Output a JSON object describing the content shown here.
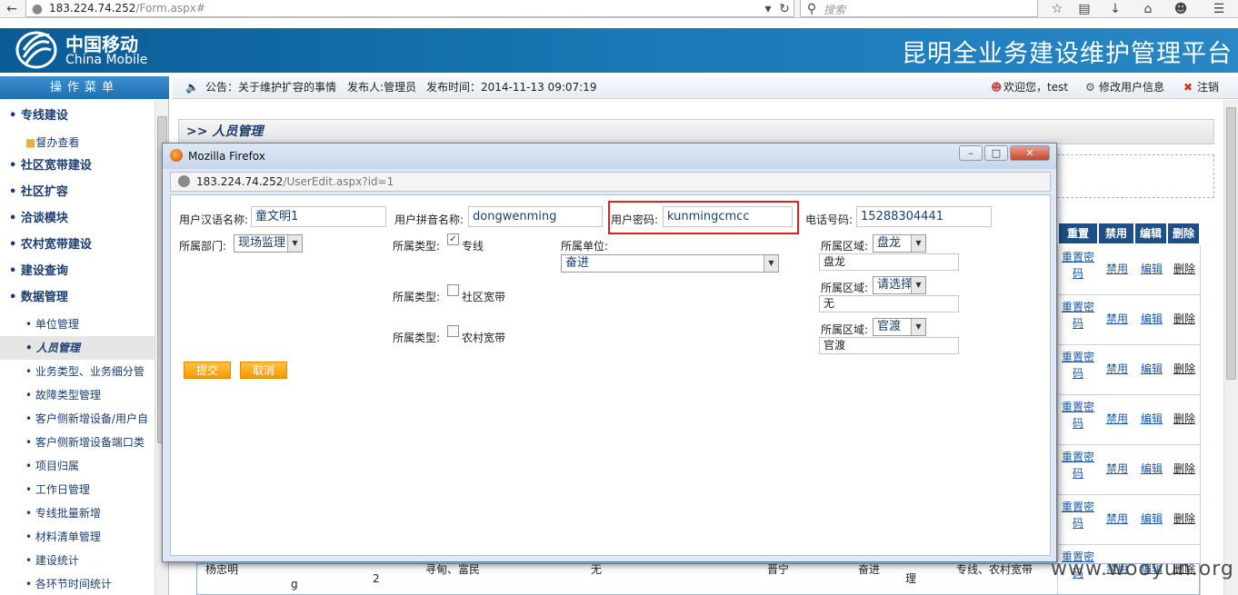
{
  "browser": {
    "url_host": "183.224.74.252",
    "url_path": "/Form.aspx#",
    "search_placeholder": "搜索"
  },
  "header": {
    "logo_cn": "中国移动",
    "logo_en": "China Mobile",
    "platform_title": "昆明全业务建设维护管理平台"
  },
  "menu_title": "操作菜单",
  "notice": {
    "text": "公告：关于维护扩容的事情",
    "publisher": "发布人:管理员",
    "time": "发布时间：2014-11-13 09:07:19",
    "welcome": "欢迎您，test",
    "edit_user": "修改用户信息",
    "logout": "注销"
  },
  "sidebar": {
    "items": [
      {
        "label": "专线建设",
        "level": "top"
      },
      {
        "label": "督办查看",
        "level": "folder"
      },
      {
        "label": "社区宽带建设",
        "level": "top"
      },
      {
        "label": "社区扩容",
        "level": "top"
      },
      {
        "label": "洽谈模块",
        "level": "top"
      },
      {
        "label": "农村宽带建设",
        "level": "top"
      },
      {
        "label": "建设查询",
        "level": "top"
      },
      {
        "label": "数据管理",
        "level": "top"
      },
      {
        "label": "单位管理",
        "level": "sub"
      },
      {
        "label": "人员管理",
        "level": "sub",
        "active": true
      },
      {
        "label": "业务类型、业务细分管",
        "level": "sub"
      },
      {
        "label": "故障类型管理",
        "level": "sub"
      },
      {
        "label": "客户侧新增设备/用户自",
        "level": "sub"
      },
      {
        "label": "客户侧新增设备端口类",
        "level": "sub"
      },
      {
        "label": "项目归属",
        "level": "sub"
      },
      {
        "label": "工作日管理",
        "level": "sub"
      },
      {
        "label": "专线批量新增",
        "level": "sub"
      },
      {
        "label": "材料清单管理",
        "level": "sub"
      },
      {
        "label": "建设统计",
        "level": "sub"
      },
      {
        "label": "各环节时间统计",
        "level": "sub"
      }
    ]
  },
  "breadcrumb": ">> 人员管理",
  "table": {
    "headers": [
      "重置",
      "禁用",
      "编辑",
      "删除"
    ],
    "row_actions": {
      "reset": "重置密码",
      "disable": "禁用",
      "edit": "编辑",
      "delete": "删除"
    },
    "bottom_row": {
      "name": "杨忠明",
      "pinyin_tail": "g",
      "num": "2",
      "units": "寻甸、富民",
      "none": "无",
      "area": "晋宁",
      "unit": "奋进",
      "dept": "理",
      "types": "专线、农村宽带"
    }
  },
  "popup": {
    "window_title": "Mozilla Firefox",
    "url_host": "183.224.74.252",
    "url_path": "/UserEdit.aspx?id=1",
    "fields": {
      "name_label": "用户汉语名称:",
      "name_value": "童文明1",
      "pinyin_label": "用户拼音名称:",
      "pinyin_value": "dongwenming",
      "password_label": "用户密码:",
      "password_value": "kunmingcmcc",
      "phone_label": "电话号码:",
      "phone_value": "15288304441",
      "dept_label": "所属部门:",
      "dept_value": "现场监理",
      "type_label": "所属类型:",
      "type1": "专线",
      "type2": "社区宽带",
      "type3": "农村宽带",
      "unit_label": "所属单位:",
      "unit_value": "奋进",
      "area_label": "所属区域:",
      "area1_select": "盘龙",
      "area1_text": "盘龙",
      "area2_select": "请选择",
      "area2_text": "无",
      "area3_select": "官渡",
      "area3_text": "官渡"
    },
    "submit": "提交",
    "cancel": "取消"
  },
  "watermark": "www.wooyun.org"
}
